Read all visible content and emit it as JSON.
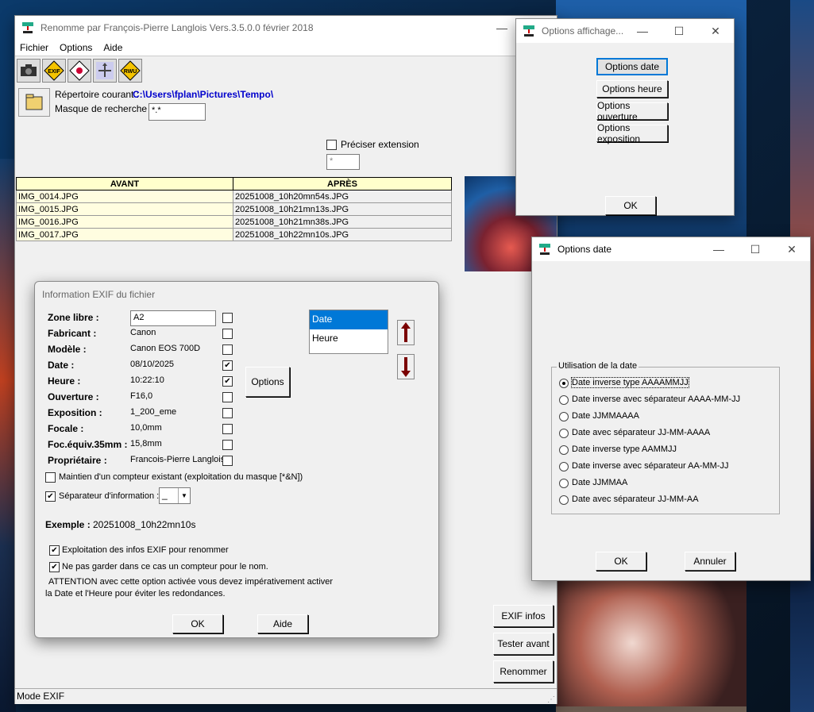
{
  "main": {
    "title": "Renomme par François-Pierre Langlois Vers.3.5.0.0 février 2018",
    "menu": [
      "Fichier",
      "Options",
      "Aide"
    ],
    "toolbar_icons": [
      "camera-icon",
      "exif-icon",
      "settings-diamond-icon",
      "arrows-icon",
      "rwu-icon"
    ],
    "rep_label": "Répertoire courant :",
    "rep_value": "C:\\Users\\fplan\\Pictures\\Tempo\\",
    "masque_label": "Masque de recherche :",
    "masque_value": "*.*",
    "preciser_label": "Préciser extension",
    "ext_value": "*",
    "table": {
      "headers": [
        "AVANT",
        "APRÈS"
      ],
      "rows": [
        [
          "IMG_0014.JPG",
          "20251008_10h20mn54s.JPG"
        ],
        [
          "IMG_0015.JPG",
          "20251008_10h21mn13s.JPG"
        ],
        [
          "IMG_0016.JPG",
          "20251008_10h21mn38s.JPG"
        ],
        [
          "IMG_0017.JPG",
          "20251008_10h22mn10s.JPG"
        ]
      ]
    },
    "buttons": {
      "exif": "EXIF infos",
      "tester": "Tester avant",
      "renommer": "Renommer"
    },
    "status": "Mode EXIF"
  },
  "exif": {
    "title": "Information EXIF du fichier",
    "fields": [
      {
        "label": "Zone libre :",
        "value": "A2",
        "checked": false
      },
      {
        "label": "Fabricant :",
        "value": "Canon",
        "checked": false
      },
      {
        "label": "Modèle :",
        "value": "Canon EOS 700D",
        "checked": false
      },
      {
        "label": "Date :",
        "value": "08/10/2025",
        "checked": true
      },
      {
        "label": "Heure :",
        "value": "10:22:10",
        "checked": true
      },
      {
        "label": "Ouverture :",
        "value": "F16,0",
        "checked": false
      },
      {
        "label": "Exposition :",
        "value": "1_200_eme",
        "checked": false
      },
      {
        "label": "Focale :",
        "value": "10,0mm",
        "checked": false
      },
      {
        "label": "Foc.équiv.35mm :",
        "value": "15,8mm",
        "checked": false
      },
      {
        "label": "Propriétaire :",
        "value": "Francois-Pierre Langlois",
        "checked": false
      }
    ],
    "options_btn": "Options",
    "order_list": [
      "Date",
      "Heure"
    ],
    "maintien_label": "Maintien d'un compteur existant (exploitation du masque [*&N])",
    "separateur_label": "Séparateur d'information :",
    "separateur_value": "_",
    "exemple_label": "Exemple :",
    "exemple_value": "20251008_10h22mn10s",
    "exploitation_label": "Exploitation des infos EXIF pour renommer",
    "nepas_label": "Ne pas  garder dans ce cas un compteur pour le nom.",
    "attention_line1": "ATTENTION avec cette option activée vous devez  impérativement activer",
    "attention_line2": " la  Date et  l'Heure pour éviter les redondances.",
    "ok": "OK",
    "aide": "Aide"
  },
  "affichage": {
    "title": "Options affichage...",
    "buttons": [
      "Options date",
      "Options heure",
      "Options ouverture",
      "Options exposition"
    ],
    "ok": "OK"
  },
  "optdate": {
    "title": "Options date",
    "group": "Utilisation de la date",
    "options": [
      "Date inverse type AAAAMMJJ",
      "Date inverse avec séparateur AAAA-MM-JJ",
      "Date JJMMAAAA",
      "Date avec séparateur JJ-MM-AAAA",
      "Date inverse type AAMMJJ",
      "Date inverse avec séparateur AA-MM-JJ",
      "Date JJMMAA",
      "Date avec séparateur JJ-MM-AA"
    ],
    "selected": 0,
    "ok": "OK",
    "annuler": "Annuler"
  }
}
